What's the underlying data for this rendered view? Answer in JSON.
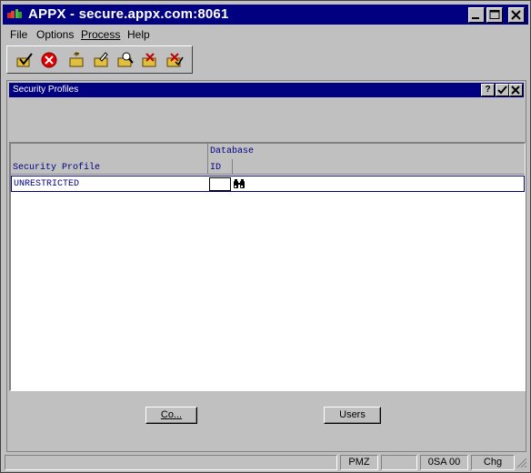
{
  "window": {
    "title": "APPX - secure.appx.com:8061"
  },
  "menu": {
    "items": [
      {
        "label": "File"
      },
      {
        "label": "Options"
      },
      {
        "label": "Process"
      },
      {
        "label": "Help"
      }
    ]
  },
  "toolbar": {
    "icons": [
      "checkmark-folder-icon",
      "cancel-icon",
      "new-record-icon",
      "edit-record-icon",
      "inquire-record-icon",
      "delete-record-icon",
      "undelete-record-icon"
    ]
  },
  "inner_window": {
    "title": "Security Profiles",
    "help_label": "?"
  },
  "grid": {
    "col_profile_header": "Security Profile",
    "col_db_header_line1": "Database",
    "col_db_header_line2": "ID",
    "rows": [
      {
        "profile": "UNRESTRICTED",
        "db_id": ""
      }
    ]
  },
  "buttons": {
    "co_label": "Co...",
    "users_label": "Users"
  },
  "status": {
    "panel_1": "",
    "panel_2": "PMZ",
    "panel_3": "",
    "panel_4": "0SA 00",
    "panel_5": "Chg"
  },
  "colors": {
    "title_bar": "#000080",
    "face": "#c0c0c0",
    "text_blue": "#000080"
  }
}
